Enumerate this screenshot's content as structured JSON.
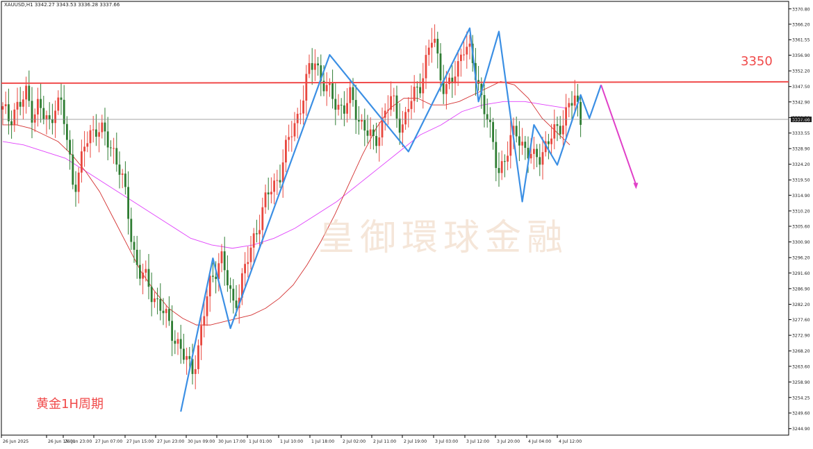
{
  "header": {
    "symbol": "XAUUSD,H1",
    "ohlc": "3342.27 3343.53 3336.28 3337.66"
  },
  "watermark": "皇御環球金融",
  "caption": "黄金1H周期",
  "colors": {
    "bull": "#e8473e",
    "bear": "#2e7d32",
    "ma_fast": "#d32f2f",
    "ma_slow": "#e040fb",
    "wave": "#3b8fe4",
    "projection": "#e040c8",
    "resistance": "#f04a4a",
    "current_price": "#888888"
  },
  "chart_data": {
    "type": "candlestick",
    "y_range": [
      3244,
      3372
    ],
    "y_ticks": [
      "3370.80",
      "3366.20",
      "3361.55",
      "3356.90",
      "3352.20",
      "3347.50",
      "3342.90",
      "3338.20",
      "3333.55",
      "3328.90",
      "3324.20",
      "3319.50",
      "3314.90",
      "3310.20",
      "3305.60",
      "3300.90",
      "3296.20",
      "3291.60",
      "3286.90",
      "3282.20",
      "3277.60",
      "3272.90",
      "3268.20",
      "3263.60",
      "3258.90",
      "3254.25",
      "3249.60",
      "3244.90"
    ],
    "x_labels": [
      "26 Jun 2025",
      "26 Jun 15:00",
      "26 Jun 23:00",
      "27 Jun 07:00",
      "27 Jun 15:00",
      "27 Jun 23:00",
      "30 Jun 09:00",
      "30 Jun 17:00",
      "1 Jul 01:00",
      "1 Jul 10:00",
      "1 Jul 18:00",
      "2 Jul 02:00",
      "2 Jul 11:00",
      "2 Jul 19:00",
      "3 Jul 03:00",
      "3 Jul 12:00",
      "3 Jul 20:00",
      "4 Jul 04:00",
      "4 Jul 12:00"
    ],
    "current_price": 3337.66,
    "current_price_label": "3337.66",
    "resistance": {
      "value": 3348.5,
      "label": "3350"
    },
    "close_path": [
      3340,
      3338,
      3341,
      3342,
      3345,
      3340,
      3342,
      3338,
      3336,
      3344,
      3341,
      3330,
      3318,
      3322,
      3330,
      3334,
      3336,
      3333,
      3330,
      3328,
      3322,
      3312,
      3300,
      3293,
      3290,
      3286,
      3284,
      3281,
      3276,
      3273,
      3270,
      3265,
      3262,
      3268,
      3278,
      3287,
      3293,
      3297,
      3289,
      3282,
      3286,
      3292,
      3298,
      3305,
      3310,
      3315,
      3318,
      3322,
      3328,
      3334,
      3339,
      3345,
      3352,
      3356,
      3350,
      3346,
      3344,
      3342,
      3341,
      3344,
      3340,
      3336,
      3333,
      3330,
      3336,
      3340,
      3344,
      3338,
      3336,
      3342,
      3346,
      3350,
      3356,
      3363,
      3354,
      3346,
      3348,
      3352,
      3361,
      3358,
      3352,
      3346,
      3340,
      3330,
      3322,
      3326,
      3330,
      3334,
      3331,
      3328,
      3325,
      3327,
      3330,
      3332,
      3334,
      3338,
      3342,
      3343,
      3338
    ],
    "wave_points": [
      [
        61,
        3250
      ],
      [
        72,
        3296
      ],
      [
        78,
        3275
      ],
      [
        112,
        3357
      ],
      [
        139,
        3328
      ],
      [
        160,
        3365
      ],
      [
        163,
        3343
      ],
      [
        170,
        3364
      ],
      [
        178,
        3313
      ],
      [
        182,
        3336
      ],
      [
        190,
        3324
      ],
      [
        198,
        3345
      ],
      [
        201,
        3338
      ],
      [
        205,
        3348
      ]
    ],
    "projection_points": [
      [
        205,
        3348
      ],
      [
        217,
        3318
      ]
    ],
    "ma_fast": [
      3336,
      3336,
      3335,
      3333,
      3331,
      3327,
      3322,
      3316,
      3308,
      3300,
      3292,
      3286,
      3281,
      3278,
      3276,
      3276,
      3277,
      3278,
      3279,
      3281,
      3284,
      3288,
      3294,
      3301,
      3309,
      3318,
      3327,
      3335,
      3341,
      3344,
      3344,
      3342,
      3342,
      3343,
      3345,
      3347,
      3349,
      3348,
      3344,
      3338,
      3334,
      3330
    ],
    "ma_slow": [
      3331,
      3330,
      3328,
      3326,
      3322,
      3318,
      3314,
      3310,
      3306,
      3302,
      3300,
      3299,
      3300,
      3302,
      3305,
      3309,
      3313,
      3318,
      3323,
      3328,
      3333,
      3336,
      3340,
      3342,
      3343,
      3343,
      3342,
      3341
    ]
  }
}
